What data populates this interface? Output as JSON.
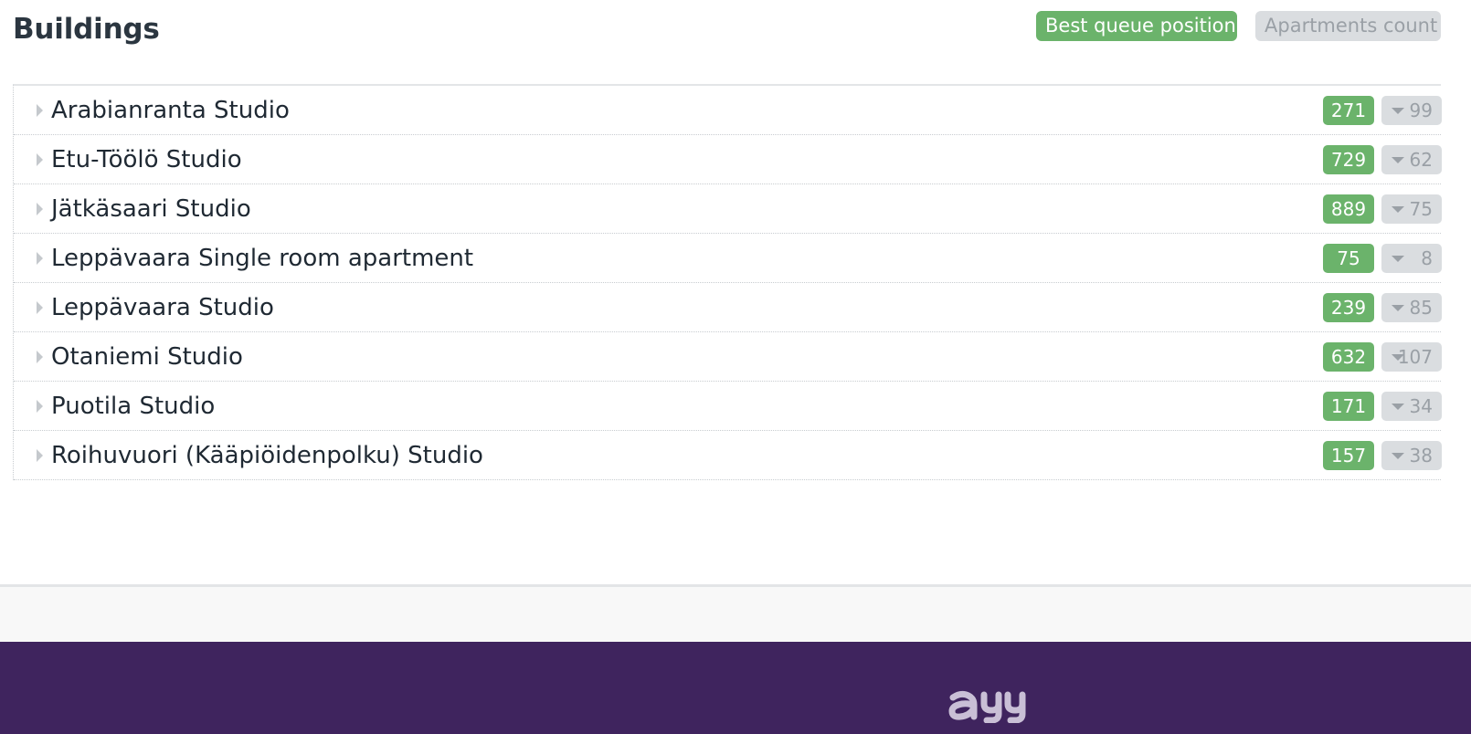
{
  "header": {
    "title": "Buildings",
    "legend": {
      "queue_label": "Best queue position",
      "count_label": "Apartments count"
    }
  },
  "buildings": [
    {
      "name": "Arabianranta Studio",
      "best_queue_position": "271",
      "apartments_count": "99"
    },
    {
      "name": "Etu-Töölö Studio",
      "best_queue_position": "729",
      "apartments_count": "62"
    },
    {
      "name": "Jätkäsaari Studio",
      "best_queue_position": "889",
      "apartments_count": "75"
    },
    {
      "name": "Leppävaara Single room apartment",
      "best_queue_position": "75",
      "apartments_count": "8"
    },
    {
      "name": "Leppävaara Studio",
      "best_queue_position": "239",
      "apartments_count": "85"
    },
    {
      "name": "Otaniemi Studio",
      "best_queue_position": "632",
      "apartments_count": "107"
    },
    {
      "name": "Puotila Studio",
      "best_queue_position": "171",
      "apartments_count": "34"
    },
    {
      "name": "Roihuvuori (Kääpiöidenpolku) Studio",
      "best_queue_position": "157",
      "apartments_count": "38"
    }
  ],
  "footer": {
    "logo_text": "ayy",
    "logo_icon": "ayy-logo"
  },
  "colors": {
    "queue_badge": "#6bb36b",
    "count_badge": "#dadde0",
    "footer_background": "#3f245e"
  }
}
